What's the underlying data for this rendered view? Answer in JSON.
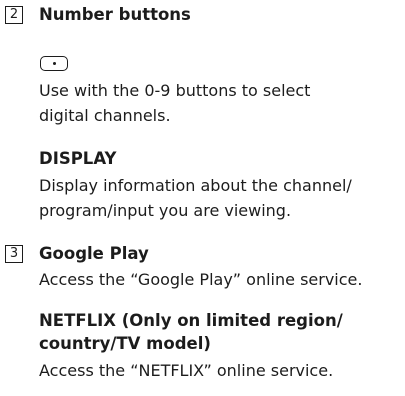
{
  "sections": [
    {
      "number": "2",
      "title": "Number buttons",
      "dot_button_icon": "dot-button-icon",
      "dot_button_desc_lines": [
        "Use with the 0-9 buttons to select",
        "digital channels."
      ],
      "display": {
        "title": "DISPLAY",
        "desc_lines": [
          "Display information about the channel/",
          "program/input you are viewing."
        ]
      }
    },
    {
      "number": "3",
      "title": "Google Play",
      "desc": "Access the “Google Play” online service.",
      "netflix": {
        "title_lines": [
          "NETFLIX (Only on limited region/",
          "country/TV model)"
        ],
        "desc": "Access the “NETFLIX” online service."
      }
    }
  ]
}
